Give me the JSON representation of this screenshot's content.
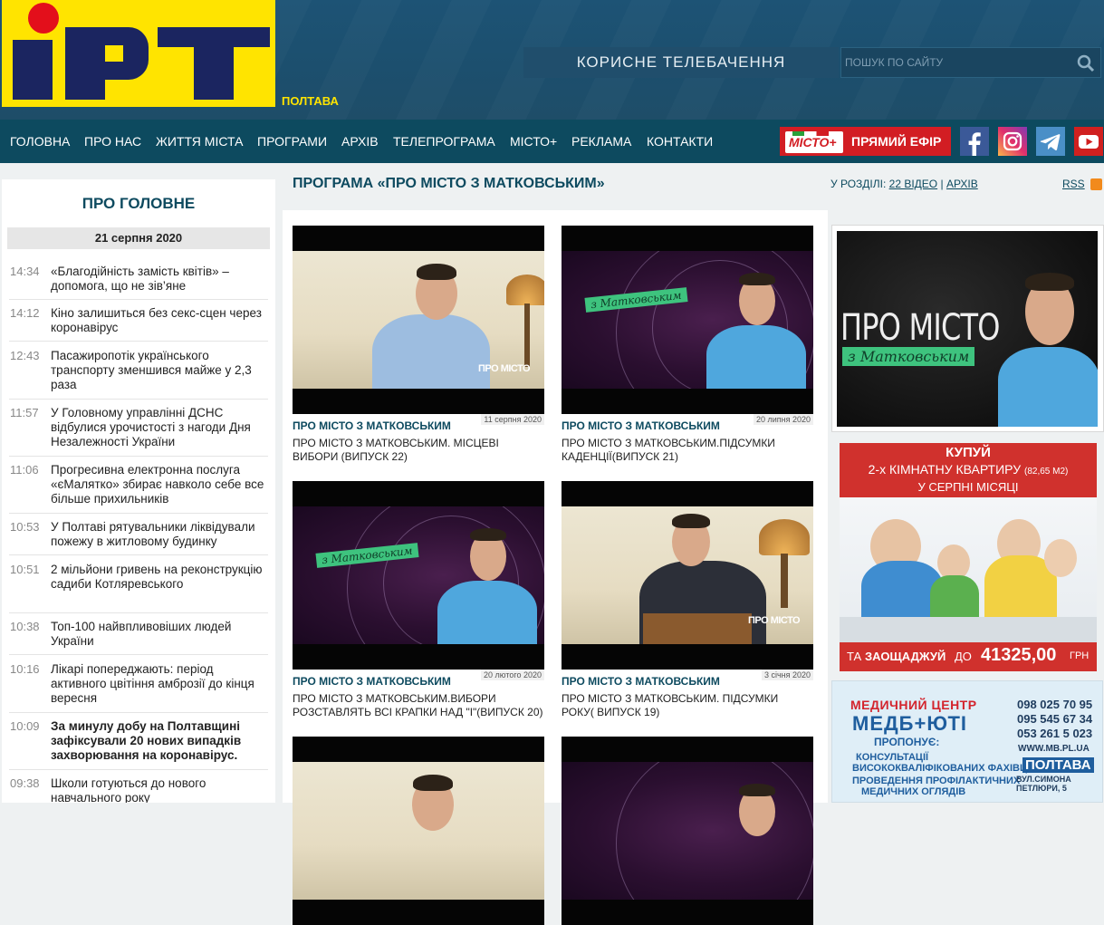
{
  "header": {
    "logo_text": "ІРТ",
    "city": "ПОЛТАВА",
    "slogan": "КОРИСНЕ ТЕЛЕБАЧЕННЯ",
    "search_placeholder": "ПОШУК ПО САЙТУ"
  },
  "nav": {
    "items": [
      "ГОЛОВНА",
      "ПРО НАС",
      "ЖИТТЯ МІСТА",
      "ПРОГРАМИ",
      "АРХІВ",
      "ТЕЛЕПРОГРАМА",
      "МІСТО+",
      "РЕКЛАМА",
      "КОНТАКТИ"
    ],
    "live_logo": "МІСТО+",
    "live_label": "ПРЯМИЙ ЕФІР",
    "social": [
      "facebook-icon",
      "instagram-icon",
      "telegram-icon",
      "youtube-icon"
    ]
  },
  "sidebar": {
    "title": "ПРО ГОЛОВНЕ",
    "date": "21 серпня 2020",
    "news": [
      {
        "time": "14:34",
        "text": "«Благодійність замість квітів» – допомога, що не зів’яне",
        "bold": false
      },
      {
        "time": "14:12",
        "text": "Кіно залишиться без секс-сцен через коронавірус",
        "bold": false
      },
      {
        "time": "12:43",
        "text": "Пасажиропотік українського транспорту зменшився майже у 2,3 раза",
        "bold": false
      },
      {
        "time": "11:57",
        "text": "У Головному управлінні ДСНС відбулися урочистості з нагоди Дня Незалежності України",
        "bold": false
      },
      {
        "time": "11:06",
        "text": "Прогресивна електронна послуга «єМалятко» збирає навколо себе все більше прихильників",
        "bold": false
      },
      {
        "time": "10:53",
        "text": "У Полтаві рятувальники ліквідували пожежу в житловому будинку",
        "bold": false
      },
      {
        "time": "10:51",
        "text": "2 мільйони гривень на реконструкцію садиби Котляревського",
        "bold": false
      },
      {
        "time": "10:38",
        "text": "Топ-100 найвпливовіших людей України",
        "bold": false
      },
      {
        "time": "10:16",
        "text": "Лікарі попереджають: період активного цвітіння амброзії до кінця вересня",
        "bold": false
      },
      {
        "time": "10:09",
        "text": "За минулу добу на Полтавщині зафіксували 20 нових випадків захворювання на коронавірус.",
        "bold": true
      },
      {
        "time": "09:38",
        "text": "Школи готуються до нового навчального року",
        "bold": false
      }
    ]
  },
  "main": {
    "title": "ПРОГРАМА «ПРО МІСТО З МАТКОВСЬКИМ»",
    "section_prefix": "У РОЗДІЛІ:",
    "videos_link": "22 ВІДЕО",
    "divider": "|",
    "archive_link": "АРХІВ",
    "rss": "RSS",
    "cards": [
      {
        "program": "ПРО МІСТО З МАТКОВСЬКИМ",
        "date": "11 серпня 2020",
        "title": "ПРО МІСТО З МАТКОВСЬКИМ. МІСЦЕВІ ВИБОРИ (ВИПУСК 22)",
        "overlay": "ПРО МІСТО"
      },
      {
        "program": "ПРО МІСТО З МАТКОВСЬКИМ",
        "date": "20 липня 2020",
        "title": "ПРО МІСТО З МАТКОВСЬКИМ.ПІДСУМКИ КАДЕНЦІЇ(ВИПУСК 21)",
        "overlay": "з Матковським"
      },
      {
        "program": "ПРО МІСТО З МАТКОВСЬКИМ",
        "date": "20 лютого 2020",
        "title": "ПРО МІСТО З МАТКОВСЬКИМ.ВИБОРИ РОЗСТАВЛЯТЬ ВСІ КРАПКИ НАД \"І\"(ВИПУСК 20)",
        "overlay": "з Матковським"
      },
      {
        "program": "ПРО МІСТО З МАТКОВСЬКИМ",
        "date": "3 січня 2020",
        "title": "ПРО МІСТО З МАТКОВСЬКИМ. ПІДСУМКИ РОКУ( ВИПУСК 19)",
        "overlay": "ПРО МІСТО"
      }
    ]
  },
  "promo": {
    "line1": "ПРО МІСТО",
    "line2": "з Матковським"
  },
  "ad_apartment": {
    "line1": "КУПУЙ",
    "line2": "2-х КІМНАТНУ  КВАРТИРУ",
    "area": "(82,65 М2)",
    "line3": "У СЕРПНІ МІСЯЦІ",
    "ta": "ТА",
    "save": "ЗАОЩАДЖУЙ",
    "do": "ДО",
    "price": "41325,00",
    "currency": "ГРН"
  },
  "ad_medical": {
    "title": "МЕДИЧНИЙ ЦЕНТР",
    "brand": "МЕДБ+ЮТІ",
    "offer": "ПРОПОНУЄ:",
    "services": [
      "КОНСУЛЬТАЦІЇ",
      "ВИСОКОКВАЛІФІКОВАНИХ ФАХІВЦІВ",
      "ПРОВЕДЕННЯ ПРОФІЛАКТИЧНИХ",
      "МЕДИЧНИХ ОГЛЯДІВ"
    ],
    "phones": [
      "098 025 70 95",
      "095 545 67 34",
      "053 261 5 023"
    ],
    "site": "WWW.MB.PL.UA",
    "city": "ПОЛТАВА",
    "address": "ВУЛ.СИМОНА ПЕТЛЮРИ, 5"
  },
  "colors": {
    "header_bg": "#1d5375",
    "nav_bg": "#0d4a5f",
    "logo_yellow": "#ffe400",
    "logo_blue": "#1b2560",
    "accent_red": "#d21d23",
    "title_teal": "#0d4a5f"
  }
}
